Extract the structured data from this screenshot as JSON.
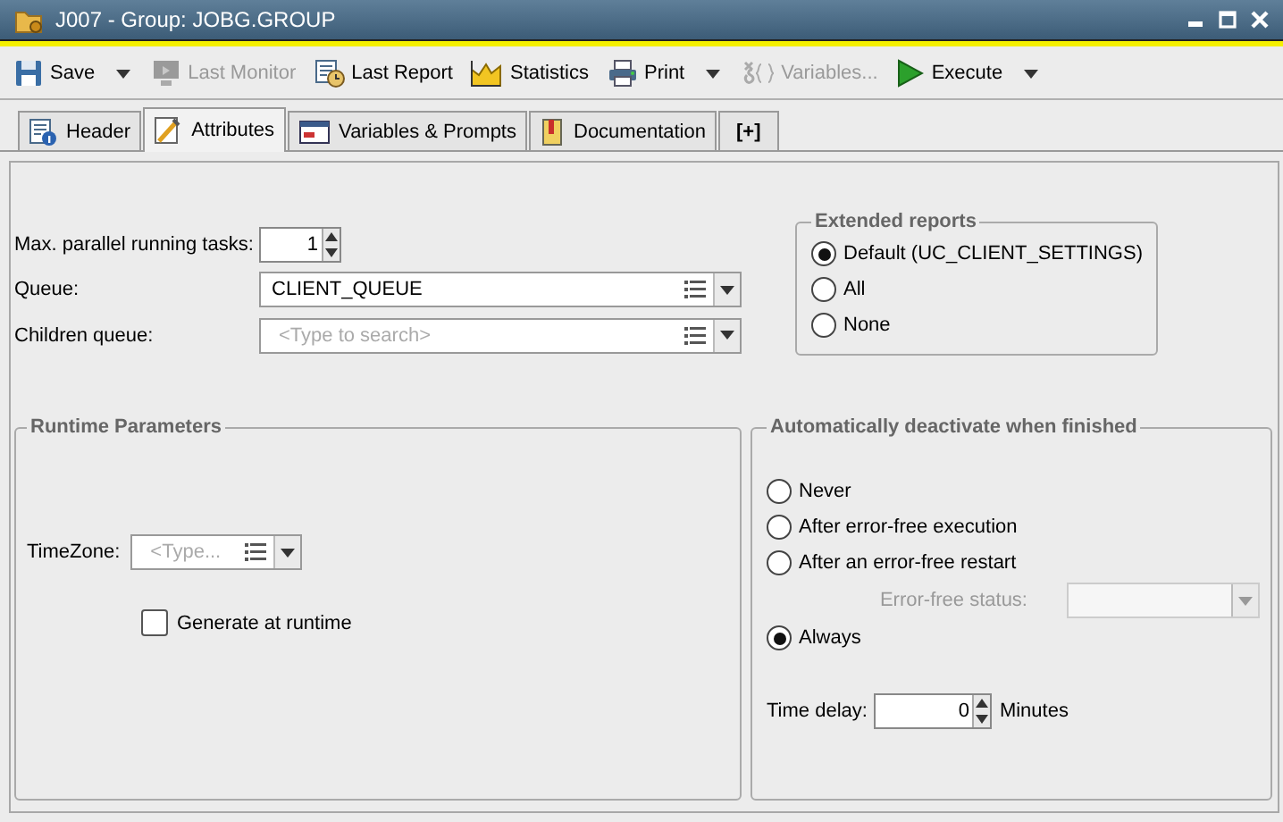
{
  "window": {
    "title": "J007 - Group: JOBG.GROUP"
  },
  "toolbar": [
    {
      "label": "Save",
      "disabled": false,
      "dropdown": true
    },
    {
      "label": "Last Monitor",
      "disabled": true,
      "dropdown": false
    },
    {
      "label": "Last Report",
      "disabled": false,
      "dropdown": false
    },
    {
      "label": "Statistics",
      "disabled": false,
      "dropdown": false
    },
    {
      "label": "Print",
      "disabled": false,
      "dropdown": true
    },
    {
      "label": "Variables...",
      "disabled": true,
      "dropdown": false
    },
    {
      "label": "Execute",
      "disabled": false,
      "dropdown": true
    }
  ],
  "tabs": [
    {
      "label": "Header",
      "selected": false
    },
    {
      "label": "Attributes",
      "selected": true
    },
    {
      "label": "Variables & Prompts",
      "selected": false
    },
    {
      "label": "Documentation",
      "selected": false
    },
    {
      "label": "[+]",
      "selected": false
    }
  ],
  "max_parallel": {
    "label": "Max. parallel running tasks:",
    "value": "1"
  },
  "queue": {
    "label": "Queue:",
    "value": "CLIENT_QUEUE"
  },
  "children_queue": {
    "label": "Children queue:",
    "placeholder": "<Type to search>"
  },
  "extended_reports": {
    "title": "Extended reports",
    "options": [
      {
        "label": "Default (UC_CLIENT_SETTINGS)",
        "selected": true
      },
      {
        "label": "All",
        "selected": false
      },
      {
        "label": "None",
        "selected": false
      }
    ]
  },
  "runtime": {
    "title": "Runtime Parameters",
    "timezone": {
      "label": "TimeZone:",
      "placeholder": "<Type..."
    },
    "generate": {
      "label": "Generate at runtime",
      "checked": false
    }
  },
  "auto_deactivate": {
    "title": "Automatically deactivate when finished",
    "options": [
      {
        "label": "Never",
        "selected": false
      },
      {
        "label": "After error-free execution",
        "selected": false
      },
      {
        "label": "After an error-free restart",
        "selected": false,
        "field": {
          "label": "Error-free status:",
          "disabled": true
        }
      },
      {
        "label": "Always",
        "selected": true
      }
    ],
    "time_delay": {
      "label": "Time delay:",
      "value": "0",
      "unit": "Minutes"
    }
  }
}
